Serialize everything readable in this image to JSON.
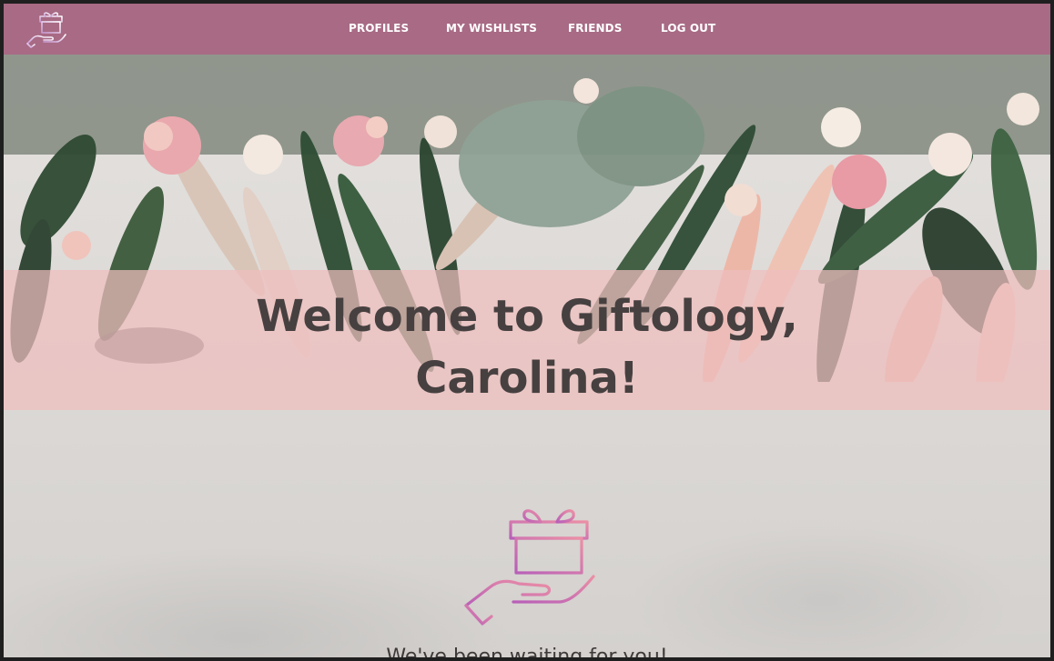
{
  "nav": {
    "logo_icon": "gift-in-hand-icon",
    "links": [
      {
        "label": "PROFILES"
      },
      {
        "label": "MY WISHLISTS"
      },
      {
        "label": "FRIENDS"
      },
      {
        "label": "LOG OUT"
      }
    ]
  },
  "hero": {
    "title_line1": "Welcome to Giftology,",
    "title_line2": "Carolina!",
    "icon": "gift-in-hand-icon",
    "tagline": "We've been waiting for you!"
  },
  "colors": {
    "navbar": "#a86a84",
    "band": "#efbebe",
    "title_text": "#474040",
    "icon_gradient_start": "#c067b5",
    "icon_gradient_end": "#e98aa6"
  }
}
